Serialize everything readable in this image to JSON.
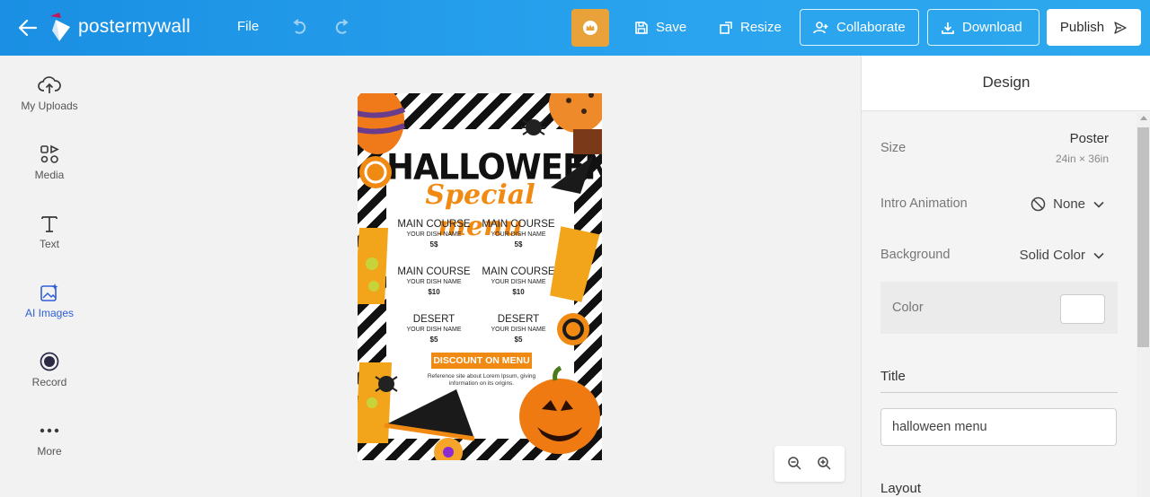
{
  "header": {
    "logo_text": "postermywall",
    "file_label": "File",
    "save_label": "Save",
    "resize_label": "Resize",
    "collaborate_label": "Collaborate",
    "download_label": "Download",
    "publish_label": "Publish"
  },
  "sidebar": {
    "items": [
      {
        "label": "My Uploads",
        "icon": "cloud-upload-icon"
      },
      {
        "label": "Media",
        "icon": "media-icon"
      },
      {
        "label": "Text",
        "icon": "text-icon"
      },
      {
        "label": "AI Images",
        "icon": "ai-images-icon",
        "active": true
      },
      {
        "label": "Record",
        "icon": "record-icon"
      },
      {
        "label": "More",
        "icon": "more-icon"
      }
    ]
  },
  "poster": {
    "title": "HALLOWEEN",
    "subtitle": "Special menu",
    "items": [
      {
        "heading": "MAIN COURSE",
        "dish": "YOUR DISH NAME",
        "price": "5$"
      },
      {
        "heading": "MAIN COURSE",
        "dish": "YOUR DISH NAME",
        "price": "5$"
      },
      {
        "heading": "MAIN COURSE",
        "dish": "YOUR DISH NAME",
        "price": "$10"
      },
      {
        "heading": "MAIN COURSE",
        "dish": "YOUR DISH NAME",
        "price": "$10"
      },
      {
        "heading": "DESERT",
        "dish": "YOUR DISH NAME",
        "price": "$5"
      },
      {
        "heading": "DESERT",
        "dish": "YOUR DISH NAME",
        "price": "$5"
      }
    ],
    "discount": "DISCOUNT ON MENU",
    "reference": "Reference site about Lorem Ipsum, giving information on its origins."
  },
  "design_panel": {
    "title": "Design",
    "size_label": "Size",
    "size_value": "Poster",
    "size_dims": "24in × 36in",
    "intro_label": "Intro Animation",
    "intro_value": "None",
    "background_label": "Background",
    "background_value": "Solid Color",
    "color_label": "Color",
    "color_value": "#ffffff",
    "title_label": "Title",
    "title_value": "halloween menu",
    "layout_label": "Layout"
  },
  "colors": {
    "accent": "#1a8fe3",
    "premium": "#e9a23a",
    "active": "#2e5ed7",
    "poster_orange": "#f08a13"
  }
}
